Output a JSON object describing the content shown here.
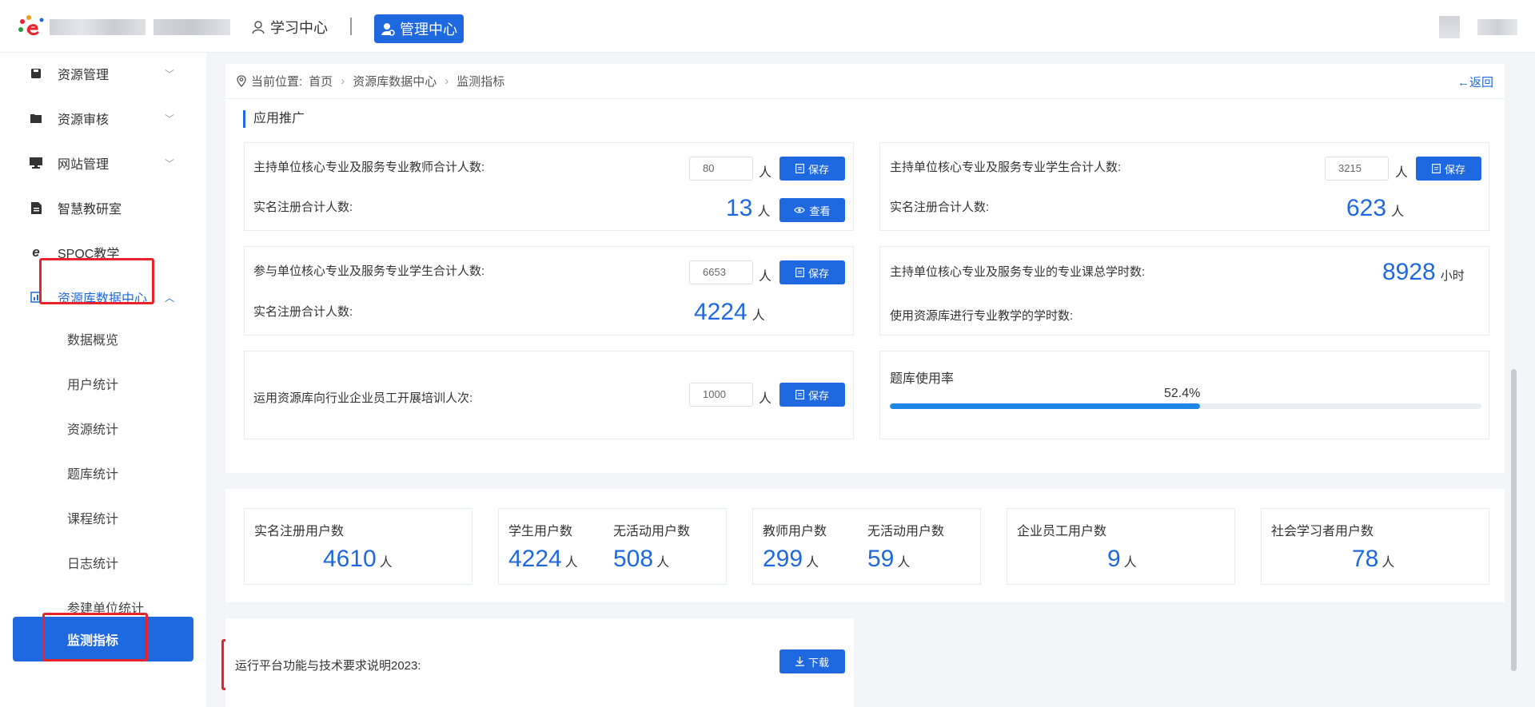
{
  "header": {
    "learn_label": "学习中心",
    "admin_label": "管理中心"
  },
  "sidebar": {
    "items": [
      {
        "label": "资源管理",
        "icon": "save-icon"
      },
      {
        "label": "资源审核",
        "icon": "folder-icon"
      },
      {
        "label": "网站管理",
        "icon": "monitor-icon"
      },
      {
        "label": "智慧教研室",
        "icon": "document-icon"
      },
      {
        "label": "SPOC教学",
        "icon": "e-icon"
      },
      {
        "label": "资源库数据中心",
        "icon": "chart-icon"
      }
    ],
    "subitems": [
      "数据概览",
      "用户统计",
      "资源统计",
      "题库统计",
      "课程统计",
      "日志统计",
      "参建单位统计",
      "监测指标"
    ]
  },
  "breadcrumb": {
    "prefix": "当前位置:",
    "items": [
      "首页",
      "资源库数据中心",
      "监测指标"
    ],
    "back": "←返回"
  },
  "section": {
    "title": "应用推广"
  },
  "cards": {
    "c1": {
      "label1": "主持单位核心专业及服务专业教师合计人数:",
      "value1": "80",
      "unit": "人",
      "save": "保存",
      "label2": "实名注册合计人数:",
      "num": "13",
      "view": "查看"
    },
    "c2": {
      "label1": "主持单位核心专业及服务专业学生合计人数:",
      "value1": "3215",
      "unit": "人",
      "save": "保存",
      "label2": "实名注册合计人数:",
      "num": "623"
    },
    "c3": {
      "label1": "参与单位核心专业及服务专业学生合计人数:",
      "value1": "6653",
      "unit": "人",
      "save": "保存",
      "label2": "实名注册合计人数:",
      "num": "4224"
    },
    "c4": {
      "label1": "主持单位核心专业及服务专业的专业课总学时数:",
      "num": "8928",
      "unit": "小时",
      "label2": "使用资源库进行专业教学的学时数:"
    },
    "c5": {
      "label1": "运用资源库向行业企业员工开展培训人次:",
      "value1": "1000",
      "unit": "人",
      "save": "保存"
    },
    "c6": {
      "title": "题库使用率",
      "percent_label": "52.4%",
      "percent": 52.4
    }
  },
  "stats": {
    "unit": "人",
    "s1": {
      "label": "实名注册用户数",
      "value": "4610"
    },
    "s2a": {
      "label": "学生用户数",
      "value": "4224"
    },
    "s2b": {
      "label": "无活动用户数",
      "value": "508"
    },
    "s3a": {
      "label": "教师用户数",
      "value": "299"
    },
    "s3b": {
      "label": "无活动用户数",
      "value": "59"
    },
    "s4": {
      "label": "企业员工用户数",
      "value": "9"
    },
    "s5": {
      "label": "社会学习者用户数",
      "value": "78"
    }
  },
  "download": {
    "label": "运行平台功能与技术要求说明2023:",
    "button": "下载"
  },
  "colors": {
    "accent": "#1f69e0",
    "highlight": "#e8232c"
  }
}
